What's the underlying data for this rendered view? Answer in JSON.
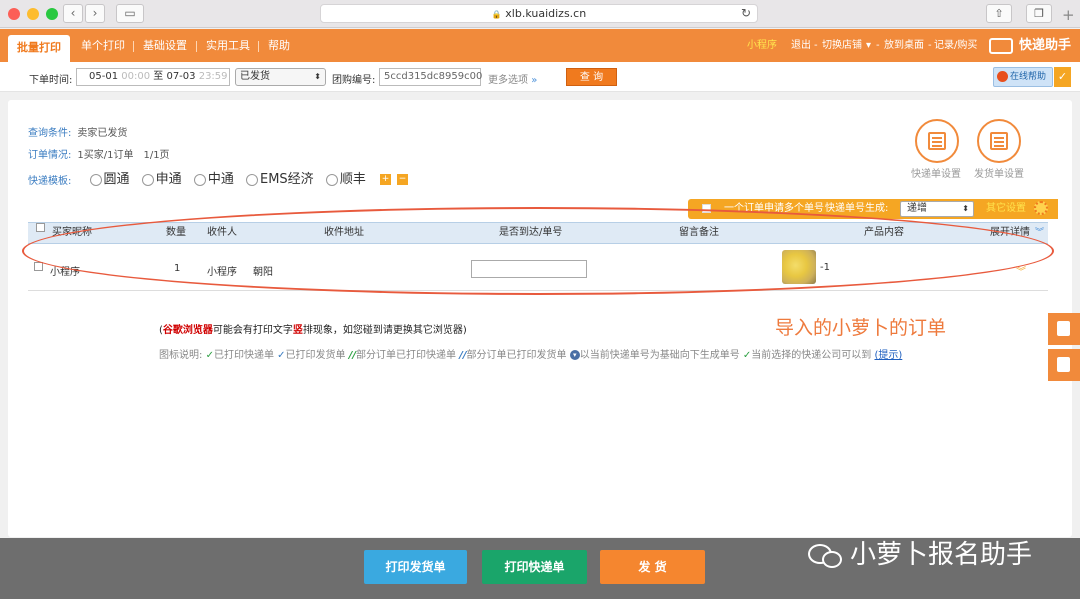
{
  "browser": {
    "url": "xlb.kuaidizs.cn",
    "back_glyph": "‹",
    "forward_glyph": "›",
    "reload_glyph": "↻",
    "lock_glyph": "🔒",
    "plus_glyph": "+"
  },
  "nav": {
    "tabs": [
      "批量打印",
      "单个打印",
      "基础设置",
      "实用工具",
      "帮助"
    ],
    "right": {
      "mini_program": "小程序",
      "logout": "退出",
      "switch_shop": "切换店铺",
      "switch_arrow": "▾",
      "desktop": "放到桌面",
      "records": "记录/购买",
      "logo": "快递助手"
    }
  },
  "filter": {
    "date_label": "下单时间:",
    "date_from": "05-01",
    "time_from": "00:00",
    "date_sep": "至",
    "date_to": "07-03",
    "time_to": "23:59",
    "status": "已发货",
    "group_label": "团购编号:",
    "group_value": "5ccd315dc8959c00",
    "more_options": "更多选项",
    "more_chevron": "»",
    "query": "查 询",
    "online_help": "在线帮助",
    "check_glyph": "✓"
  },
  "summary": {
    "condition_label": "查询条件:",
    "condition_value": "卖家已发货",
    "orders_label": "订单情况:",
    "orders_value": "1买家/1订单　1/1页",
    "express_label": "快递模板:",
    "couriers": [
      "圆通",
      "申通",
      "中通",
      "EMS经济",
      "顺丰"
    ],
    "add_glyph": "+",
    "minus_glyph": "−"
  },
  "settings": {
    "express_settings": "快递单设置",
    "invoice_settings": "发货单设置"
  },
  "toolbar": {
    "multi_waybill": "一个订单申请多个单号",
    "gen_label": "快递单号生成:",
    "gen_mode": "递增",
    "other_settings": "其它设置"
  },
  "table": {
    "headers": {
      "buyer": "买家昵称",
      "qty": "数量",
      "receiver": "收件人",
      "address": "收件地址",
      "reach": "是否到达/单号",
      "remark": "留言备注",
      "product": "产品内容",
      "expand": "展开详情",
      "expand_glyph": "︾"
    },
    "rows": [
      {
        "buyer": "小程序",
        "qty": "1",
        "receiver": "小程序",
        "address": "朝阳",
        "product_suffix": "-1",
        "expand_glyph": "︾"
      }
    ]
  },
  "annotation": "导入的小萝卜的订单",
  "warning": {
    "open_paren": "(",
    "browser_name": "谷歌浏览器",
    "mid": "可能会有打印文字",
    "char": "竖",
    "tail": "排现象，如您碰到请更换其它浏览器)"
  },
  "legend": {
    "label": "图标说明:",
    "check_glyph": "✓",
    "double_glyph": "//",
    "down_glyph": "▾",
    "printed_express": "已打印快递单",
    "printed_invoice": "已打印发货单",
    "partial_express": "部分订单已打印快递单",
    "partial_invoice": "部分订单已打印发货单",
    "base_gen": "以当前快递单号为基础向下生成单号",
    "reach_ok": "当前选择的快递公司可以到",
    "hint": "(提示)"
  },
  "bottom": {
    "print_invoice": "打印发货单",
    "print_express": "打印快递单",
    "ship": "发 货"
  },
  "watermark": "小萝卜报名助手"
}
